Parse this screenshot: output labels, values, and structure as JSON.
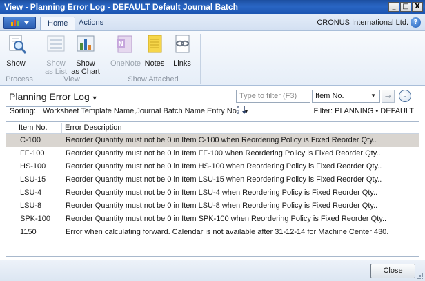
{
  "window": {
    "title": "View - Planning Error Log - DEFAULT Default Journal Batch",
    "minimize": "_",
    "maximize": "□",
    "close": "X"
  },
  "ribbon": {
    "tabs": [
      {
        "label": "Home",
        "active": true
      },
      {
        "label": "Actions",
        "active": false
      }
    ],
    "company": "CRONUS International Ltd.",
    "help": "?",
    "buttons": {
      "show": "Show",
      "show_as_list": "Show as List",
      "show_as_chart": "Show as Chart",
      "onenote": "OneNote",
      "notes": "Notes",
      "links": "Links"
    },
    "groups": {
      "process": "Process",
      "view": "View",
      "show_attached": "Show Attached"
    }
  },
  "page": {
    "title": "Planning Error Log",
    "filter_placeholder": "Type to filter (F3)",
    "filter_field": "Item No.",
    "sorting_label": "Sorting:",
    "sorting_value": "Worksheet Template Name,Journal Batch Name,Entry No.",
    "filter_info": "Filter: PLANNING • DEFAULT"
  },
  "grid": {
    "columns": [
      "Item No.",
      "Error Description"
    ],
    "rows": [
      {
        "item": "C-100",
        "desc": "Reorder Quantity must not be 0 in Item C-100 when Reordering Policy is Fixed Reorder Qty..",
        "selected": true
      },
      {
        "item": "FF-100",
        "desc": "Reorder Quantity must not be 0 in Item FF-100 when Reordering Policy is Fixed Reorder Qty..",
        "selected": false
      },
      {
        "item": "HS-100",
        "desc": "Reorder Quantity must not be 0 in Item HS-100 when Reordering Policy is Fixed Reorder Qty..",
        "selected": false
      },
      {
        "item": "LSU-15",
        "desc": "Reorder Quantity must not be 0 in Item LSU-15 when Reordering Policy is Fixed Reorder Qty..",
        "selected": false
      },
      {
        "item": "LSU-4",
        "desc": "Reorder Quantity must not be 0 in Item LSU-4 when Reordering Policy is Fixed Reorder Qty..",
        "selected": false
      },
      {
        "item": "LSU-8",
        "desc": "Reorder Quantity must not be 0 in Item LSU-8 when Reordering Policy is Fixed Reorder Qty..",
        "selected": false
      },
      {
        "item": "SPK-100",
        "desc": "Reorder Quantity must not be 0 in Item SPK-100 when Reordering Policy is Fixed Reorder Qty..",
        "selected": false
      },
      {
        "item": "1150",
        "desc": "Error when calculating forward. Calendar is not available after 31-12-14 for Machine Center 430.",
        "selected": false
      }
    ]
  },
  "footer": {
    "close_label": "Close"
  },
  "colors": {
    "title_bar": "#2a66c4",
    "selected_row": "#d9d5d0",
    "ribbon_bg": "#e6eef8"
  }
}
